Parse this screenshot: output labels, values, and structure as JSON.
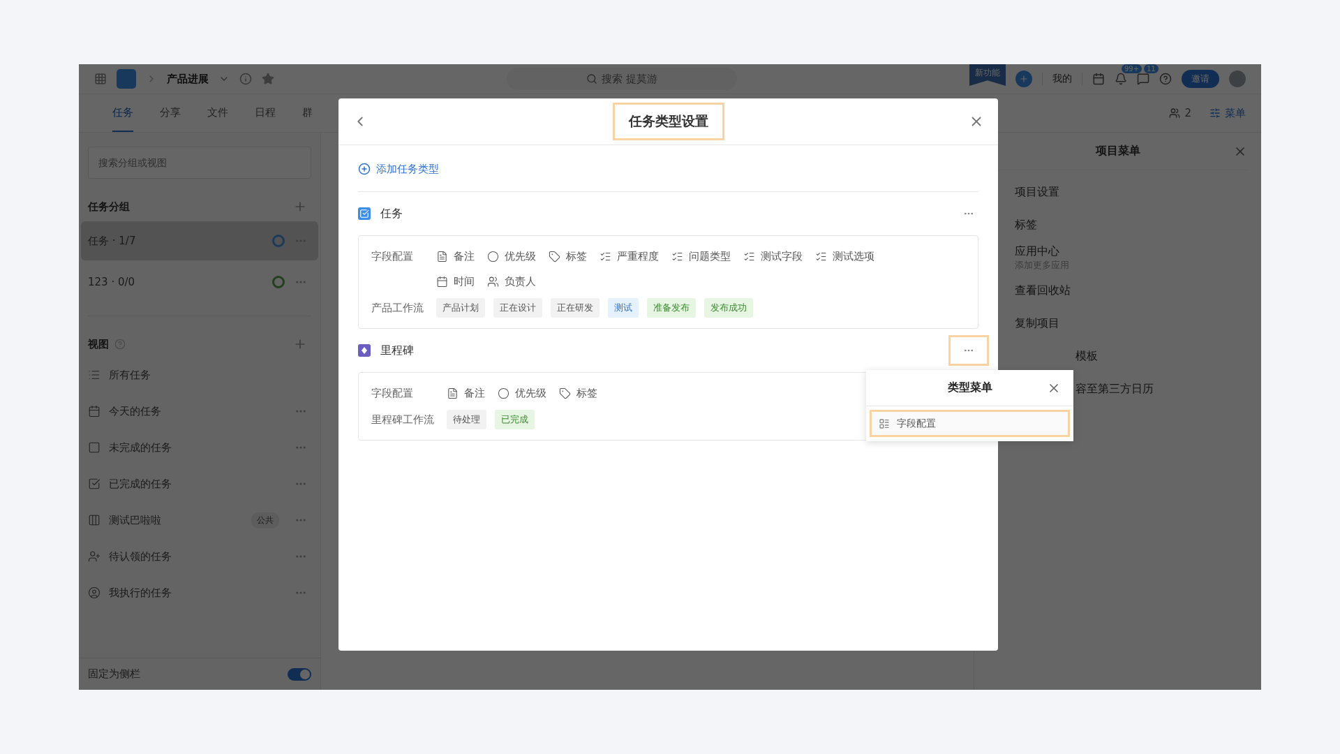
{
  "topbar": {
    "project": "产品进展",
    "search": "搜索 提莫游",
    "new_badge": "新功能",
    "mine": "我的",
    "notifications": "99+",
    "messages": "11",
    "invite": "邀请"
  },
  "tabs": [
    {
      "label": "任务",
      "selected": true
    },
    {
      "label": "分享",
      "selected": false
    },
    {
      "label": "文件",
      "selected": false
    },
    {
      "label": "日程",
      "selected": false
    },
    {
      "label": "群",
      "selected": false
    }
  ],
  "members": "2",
  "menu_link": "菜单",
  "sidebar": {
    "search_placeholder": "搜索分组或视图",
    "groups_title": "任务分组",
    "groups": [
      {
        "label": "任务 · 1/7",
        "selected": true
      },
      {
        "label": "123 · 0/0",
        "selected": false
      }
    ],
    "views_title": "视图",
    "views": [
      {
        "label": "所有任务",
        "kind": "list",
        "more": false
      },
      {
        "label": "今天的任务",
        "kind": "calendar",
        "more": true
      },
      {
        "label": "未完成的任务",
        "kind": "square",
        "more": true
      },
      {
        "label": "已完成的任务",
        "kind": "check",
        "more": true
      },
      {
        "label": "测试巴啦啦",
        "kind": "columns",
        "more": true,
        "badge": "公共"
      },
      {
        "label": "待认领的任务",
        "kind": "claim",
        "more": true
      },
      {
        "label": "我执行的任务",
        "kind": "mine",
        "more": true
      }
    ],
    "pin_label": "固定为侧栏",
    "pin_on": true
  },
  "project_menu": {
    "title": "项目菜单",
    "items": [
      {
        "label": "项目设置",
        "kind": "full"
      },
      {
        "label": "标签",
        "kind": "full"
      },
      {
        "label": "应用中心",
        "kind": "full",
        "sub": "添加更多应用"
      },
      {
        "label": "查看回收站",
        "kind": "full"
      },
      {
        "label": "复制项目",
        "kind": "full"
      },
      {
        "label": "模板",
        "kind": "partial"
      },
      {
        "label": "容至第三方日历",
        "kind": "partial"
      }
    ]
  },
  "modal": {
    "title": "任务类型设置",
    "title_highlighted": true,
    "add_label": "添加任务类型",
    "types": [
      {
        "name": "任务",
        "kind": "task",
        "more_highlighted": false,
        "fields_label": "字段配置",
        "fields": [
          {
            "label": "备注",
            "kind": "note"
          },
          {
            "label": "优先级",
            "kind": "priority"
          },
          {
            "label": "标签",
            "kind": "tag"
          },
          {
            "label": "严重程度",
            "kind": "select"
          },
          {
            "label": "问题类型",
            "kind": "select"
          },
          {
            "label": "测试字段",
            "kind": "select"
          },
          {
            "label": "测试选项",
            "kind": "select"
          },
          {
            "label": "时间",
            "kind": "date"
          },
          {
            "label": "负责人",
            "kind": "assignee"
          }
        ],
        "workflow_label": "产品工作流",
        "stages": [
          {
            "label": "产品计划",
            "color": "#f2f2f2"
          },
          {
            "label": "正在设计",
            "color": "#f2f2f2"
          },
          {
            "label": "正在研发",
            "color": "#f2f2f2"
          },
          {
            "label": "测试",
            "color": "#e5f1fd"
          },
          {
            "label": "准备发布",
            "color": "#e7f5e3"
          },
          {
            "label": "发布成功",
            "color": "#e7f5e3"
          }
        ]
      },
      {
        "name": "里程碑",
        "kind": "milestone",
        "more_highlighted": true,
        "fields_label": "字段配置",
        "fields": [
          {
            "label": "备注",
            "kind": "note"
          },
          {
            "label": "优先级",
            "kind": "priority"
          },
          {
            "label": "标签",
            "kind": "tag"
          }
        ],
        "workflow_label": "里程碑工作流",
        "stages": [
          {
            "label": "待处理",
            "color": "#f2f2f2"
          },
          {
            "label": "已完成",
            "color": "#e7f5e3"
          }
        ]
      }
    ]
  },
  "type_menu": {
    "title": "类型菜单",
    "items": [
      {
        "label": "字段配置",
        "highlighted": true
      }
    ]
  }
}
